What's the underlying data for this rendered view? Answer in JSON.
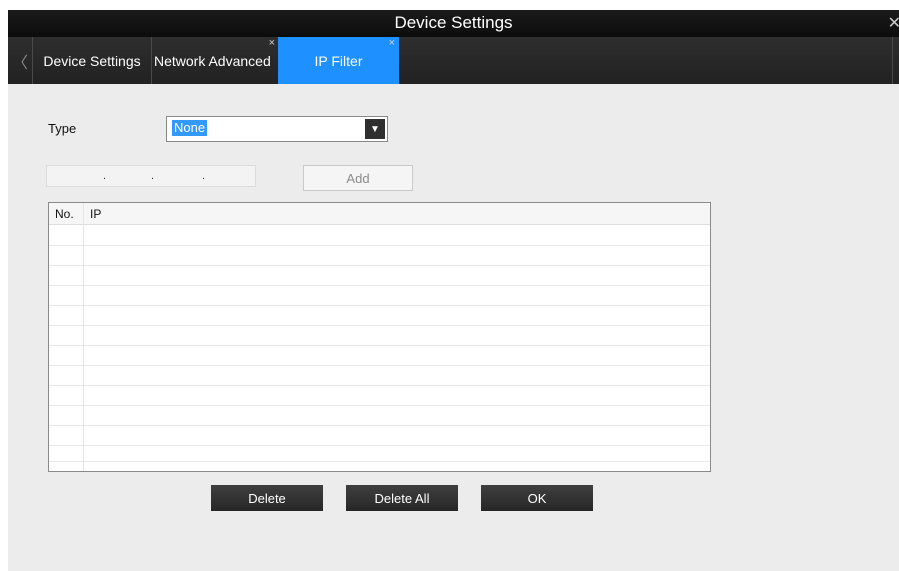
{
  "window": {
    "title": "Device Settings",
    "close_glyph": "✕"
  },
  "tabs": [
    {
      "label": "Device Settings",
      "closable": false,
      "active": false
    },
    {
      "label": "Network Advanced",
      "closable": true,
      "active": false
    },
    {
      "label": "IP Filter",
      "closable": true,
      "active": true
    }
  ],
  "tab_close_glyph": "×",
  "tab_prev_glyph": "〈",
  "form": {
    "type_label": "Type",
    "type_value": "None",
    "dropdown_arrow": "▼",
    "ip_input_dots": [
      ".",
      ".",
      "."
    ],
    "add_label": "Add"
  },
  "table": {
    "columns": [
      "No.",
      "IP"
    ],
    "rows": []
  },
  "actions": {
    "delete_label": "Delete",
    "delete_all_label": "Delete All",
    "ok_label": "OK"
  },
  "colors": {
    "accent": "#1e90ff",
    "titlebar": "#111111",
    "background": "#ececec"
  }
}
